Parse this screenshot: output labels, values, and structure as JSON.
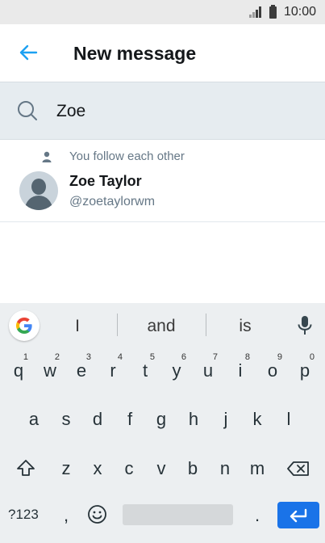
{
  "status_bar": {
    "time": "10:00"
  },
  "header": {
    "title": "New message",
    "back_icon": "arrow-left-icon",
    "accent": "#1da1f2"
  },
  "search": {
    "query": "Zoe",
    "icon": "search-icon"
  },
  "result": {
    "relationship": "You follow each other",
    "name": "Zoe Taylor",
    "handle": "@zoetaylorwm"
  },
  "keyboard": {
    "suggestions": [
      "I",
      "and",
      "is"
    ],
    "row1": [
      {
        "k": "q",
        "n": "1"
      },
      {
        "k": "w",
        "n": "2"
      },
      {
        "k": "e",
        "n": "3"
      },
      {
        "k": "r",
        "n": "4"
      },
      {
        "k": "t",
        "n": "5"
      },
      {
        "k": "y",
        "n": "6"
      },
      {
        "k": "u",
        "n": "7"
      },
      {
        "k": "i",
        "n": "8"
      },
      {
        "k": "o",
        "n": "9"
      },
      {
        "k": "p",
        "n": "0"
      }
    ],
    "row2": [
      "a",
      "s",
      "d",
      "f",
      "g",
      "h",
      "j",
      "k",
      "l"
    ],
    "row3": [
      "z",
      "x",
      "c",
      "v",
      "b",
      "n",
      "m"
    ],
    "symbols_label": "?123",
    "comma": ",",
    "period": ".",
    "enter_color": "#1a73e8"
  }
}
